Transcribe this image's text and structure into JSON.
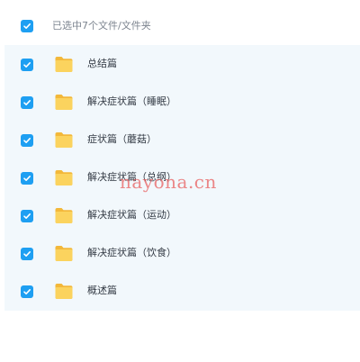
{
  "header": {
    "select_all_checked": true,
    "selection_text": "已选中7个文件/文件夹"
  },
  "files": [
    {
      "name": "总结篇",
      "checked": true,
      "icon": "folder-icon"
    },
    {
      "name": "解决症状篇（睡眠）",
      "checked": true,
      "icon": "folder-icon"
    },
    {
      "name": "症状篇（蘑菇）",
      "checked": true,
      "icon": "folder-icon"
    },
    {
      "name": "解决症状篇（总纲）",
      "checked": true,
      "icon": "folder-icon"
    },
    {
      "name": "解决症状篇（运动）",
      "checked": true,
      "icon": "folder-icon"
    },
    {
      "name": "解决症状篇（饮食）",
      "checked": true,
      "icon": "folder-icon"
    },
    {
      "name": "概述篇",
      "checked": true,
      "icon": "folder-icon"
    }
  ],
  "watermark": "nayona.cn",
  "colors": {
    "checkbox": "#1e9ff2",
    "folder": "#f7c948",
    "list_background": "#f2f8fc",
    "watermark": "#e85a5a"
  }
}
